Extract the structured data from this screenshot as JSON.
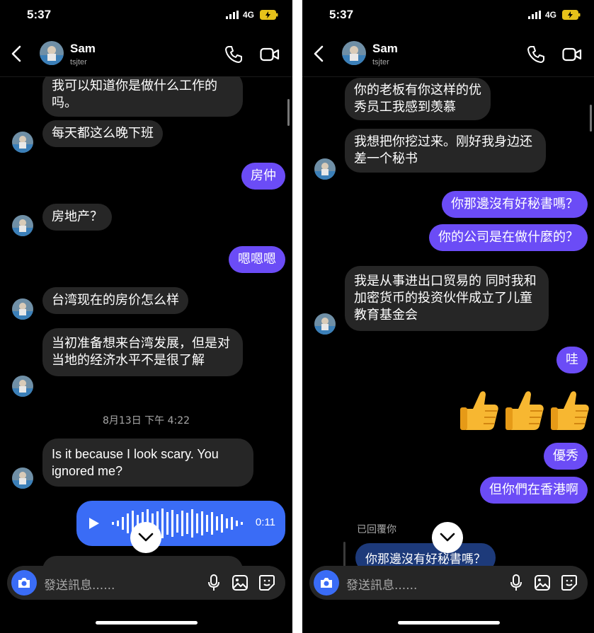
{
  "left": {
    "status": {
      "time": "5:37",
      "network": "4G"
    },
    "header": {
      "name": "Sam",
      "handle": "tsjter"
    },
    "messages": {
      "m1": "我可以知道你是做什么工作的吗。",
      "m2": "每天都这么晚下班",
      "m3": "房仲",
      "m4": "房地产？",
      "m5": "嗯嗯嗯",
      "m6": "台湾现在的房价怎么样",
      "m7": "当初准备想来台湾发展，但是对当地的经济水平不是很了解",
      "timestamp": "8月13日 下午 4:22",
      "m8": "Is it because I look scary. You ignored me?",
      "voice_duration": "0:11"
    },
    "composer": {
      "placeholder": "發送訊息......"
    }
  },
  "right": {
    "status": {
      "time": "5:37",
      "network": "4G"
    },
    "header": {
      "name": "Sam",
      "handle": "tsjter"
    },
    "messages": {
      "m1": "你的老板有你这样的优秀员工我感到羡慕",
      "m2": "我想把你挖过来。刚好我身边还差一个秘书",
      "m3": "你那邊沒有好秘書嗎？",
      "m4": "你的公司是在做什麼的？",
      "m5": "我是从事进出口贸易的 同时我和加密货币的投资伙伴成立了儿童教育基金会",
      "m6": "哇",
      "m7": "優秀",
      "m8": "但你們在香港啊",
      "replied_label": "已回覆你",
      "quoted": "你那邊沒有好秘書嗎？"
    },
    "composer": {
      "placeholder": "發送訊息......"
    }
  },
  "icons": {
    "back": "chevron-left-icon",
    "phone": "phone-icon",
    "video": "video-camera-icon",
    "camera": "camera-icon",
    "mic": "microphone-icon",
    "image": "image-icon",
    "sticker": "sticker-icon",
    "thumbs": "thumbs-up-emoji"
  },
  "colors": {
    "background": "#000000",
    "incoming_bubble": "#262626",
    "outgoing_bubble": "#6b4cf6",
    "voice_bubble": "#3a6cf6",
    "quoted_bubble": "#1d3a7a"
  }
}
